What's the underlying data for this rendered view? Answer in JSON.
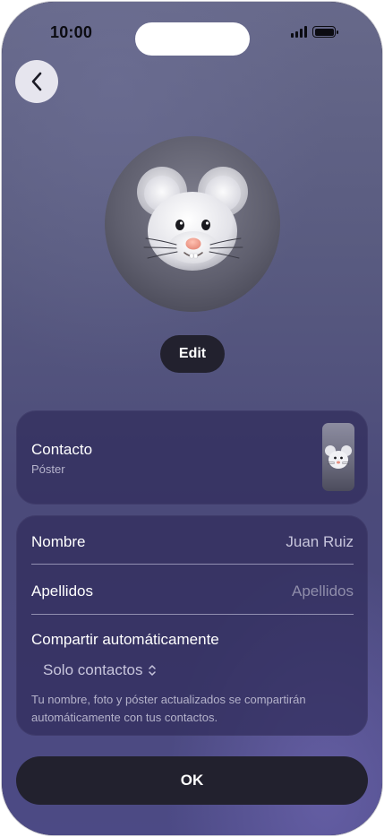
{
  "status_bar": {
    "time": "10:00",
    "icons": [
      "cellular-signal-icon",
      "battery-icon"
    ]
  },
  "header": {
    "back_icon": "chevron-left-icon"
  },
  "avatar": {
    "icon": "mouse-memoji-icon"
  },
  "edit_button": {
    "label": "Edit"
  },
  "poster": {
    "title": "Contacto",
    "subtitle": "Póster",
    "thumbnail_icon": "mouse-memoji-poster-icon"
  },
  "fields": {
    "first_name": {
      "label": "Nombre",
      "value": "Juan Ruiz"
    },
    "last_name": {
      "label": "Apellidos",
      "placeholder": "Apellidos"
    },
    "auto_share": {
      "label": "Compartir automáticamente",
      "selected": "Solo contactos",
      "selector_icon": "chevron-up-down-icon"
    },
    "footnote": "Tu nombre, foto y póster actualizados se compartirán automáticamente con tus contactos."
  },
  "ok_button": {
    "label": "OK"
  },
  "colors": {
    "background_top": "#67698a",
    "background_bottom": "#4c4a85",
    "card": "#302c5c",
    "button_dark": "#22212e",
    "text_primary": "#ffffff",
    "text_secondary": "#b6b4cc"
  }
}
